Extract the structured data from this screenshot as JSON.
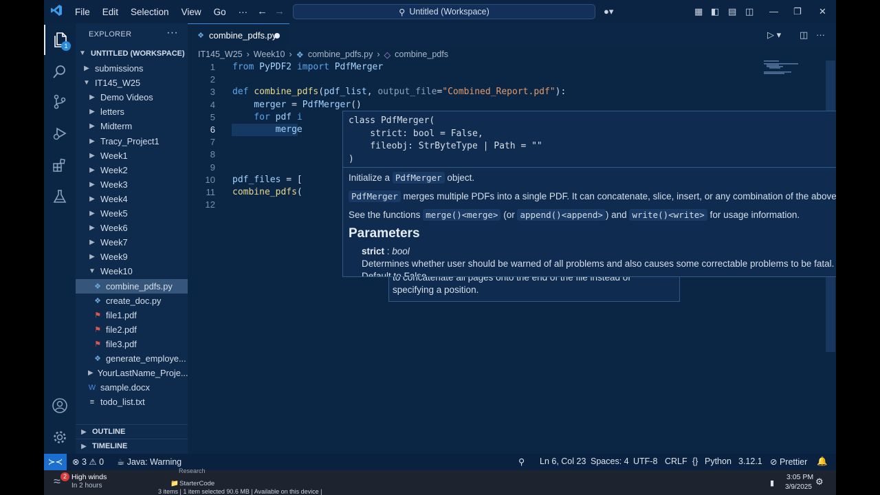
{
  "titlebar": {
    "logo": "<",
    "menus": [
      "File",
      "Edit",
      "Selection",
      "View",
      "Go",
      "···"
    ],
    "search_text": "Untitled (Workspace)"
  },
  "activity": {
    "explorer_badge": "1"
  },
  "sidebar": {
    "title": "EXPLORER",
    "workspace": "UNTITLED (WORKSPACE)",
    "items": [
      {
        "label": "submissions",
        "kind": "folder",
        "indent": 1
      },
      {
        "label": "IT145_W25",
        "kind": "folder-open",
        "indent": 1
      },
      {
        "label": "Demo Videos",
        "kind": "folder",
        "indent": 2
      },
      {
        "label": "letters",
        "kind": "folder",
        "indent": 2
      },
      {
        "label": "Midterm",
        "kind": "folder",
        "indent": 2
      },
      {
        "label": "Tracy_Project1",
        "kind": "folder",
        "indent": 2
      },
      {
        "label": "Week1",
        "kind": "folder",
        "indent": 2
      },
      {
        "label": "Week2",
        "kind": "folder",
        "indent": 2
      },
      {
        "label": "Week3",
        "kind": "folder",
        "indent": 2
      },
      {
        "label": "Week4",
        "kind": "folder",
        "indent": 2
      },
      {
        "label": "Week5",
        "kind": "folder",
        "indent": 2
      },
      {
        "label": "Week6",
        "kind": "folder",
        "indent": 2
      },
      {
        "label": "Week7",
        "kind": "folder",
        "indent": 2
      },
      {
        "label": "Week9",
        "kind": "folder",
        "indent": 2
      },
      {
        "label": "Week10",
        "kind": "folder-open",
        "indent": 2
      },
      {
        "label": "combine_pdfs.py",
        "kind": "py",
        "indent": 3
      },
      {
        "label": "create_doc.py",
        "kind": "py",
        "indent": 3
      },
      {
        "label": "file1.pdf",
        "kind": "pdf",
        "indent": 3
      },
      {
        "label": "file2.pdf",
        "kind": "pdf",
        "indent": 3
      },
      {
        "label": "file3.pdf",
        "kind": "pdf",
        "indent": 3
      },
      {
        "label": "generate_employe...",
        "kind": "py",
        "indent": 3
      },
      {
        "label": "YourLastName_Proje...",
        "kind": "folder",
        "indent": 2
      },
      {
        "label": "sample.docx",
        "kind": "doc",
        "indent": 2
      },
      {
        "label": "todo_list.txt",
        "kind": "txt",
        "indent": 2
      }
    ],
    "selected_index": 15,
    "outline": "OUTLINE",
    "timeline": "TIMELINE"
  },
  "editor": {
    "tab_label": "combine_pdfs.py",
    "breadcrumb": [
      "IT145_W25",
      "Week10",
      "combine_pdfs.py",
      "combine_pdfs"
    ],
    "line_numbers": [
      "1",
      "2",
      "3",
      "4",
      "5",
      "6",
      "7",
      "8",
      "9",
      "10",
      "11",
      "12"
    ],
    "current_line": "6",
    "code_lines": [
      [
        {
          "t": "from ",
          "c": "kw"
        },
        {
          "t": "PyPDF2 ",
          "c": "var"
        },
        {
          "t": "import ",
          "c": "kw"
        },
        {
          "t": "PdfMerger",
          "c": "var"
        }
      ],
      [],
      [
        {
          "t": "def ",
          "c": "kw"
        },
        {
          "t": "combine_pdfs",
          "c": "fn"
        },
        {
          "t": "(",
          "c": "plain"
        },
        {
          "t": "pdf_list",
          "c": "var"
        },
        {
          "t": ", ",
          "c": "plain"
        },
        {
          "t": "output_file",
          "c": "param"
        },
        {
          "t": "=",
          "c": "plain"
        },
        {
          "t": "\"Combined_Report.pdf\"",
          "c": "str"
        },
        {
          "t": "):",
          "c": "plain"
        }
      ],
      [
        {
          "t": "    merger ",
          "c": "var"
        },
        {
          "t": "= ",
          "c": "plain"
        },
        {
          "t": "PdfMerger",
          "c": "var"
        },
        {
          "t": "()",
          "c": "plain"
        }
      ],
      [
        {
          "t": "    for ",
          "c": "kw"
        },
        {
          "t": "pdf ",
          "c": "var"
        },
        {
          "t": "i",
          "c": "kw"
        }
      ],
      [
        {
          "t": "        merge",
          "c": "var"
        }
      ],
      [],
      [],
      [],
      [
        {
          "t": "pdf_files ",
          "c": "var"
        },
        {
          "t": "= [",
          "c": "plain"
        }
      ],
      [
        {
          "t": "combine_pdfs",
          "c": "fn"
        },
        {
          "t": "(",
          "c": "plain"
        }
      ],
      []
    ]
  },
  "hover": {
    "signature": "class PdfMerger(\n    strict: bool = False,\n    fileobj: StrByteType | Path = \"\"\n)",
    "intro_pre": "Initialize a",
    "intro_code": "PdfMerger",
    "intro_post": "object.",
    "desc_code": "PdfMerger",
    "desc_text": "merges multiple PDFs into a single PDF. It can concatenate, slice, insert, or any combination of the above.",
    "see_pre": "See the functions",
    "see_merge": "merge()<merge>",
    "see_or": "(or",
    "see_append": "append()<append>",
    "see_and": ") and",
    "see_write": "write()<write>",
    "see_post": "for usage information.",
    "params_heading": "Parameters",
    "param_name": "strict",
    "param_sep": " : ",
    "param_type": "bool",
    "param_desc": "Determines whether user should be warned of all problems and also causes some correctable problems to be fatal.",
    "param_cut": "Default to False"
  },
  "hover2": {
    "line1": "to concatenate all pages onto the end of the file instead of",
    "line2": "specifying a position."
  },
  "status": {
    "errors": "3",
    "warnings": "0",
    "java": "Java: Warning",
    "position": "Ln 6, Col 23",
    "spaces": "Spaces: 4",
    "encoding": "UTF-8",
    "eol": "CRLF",
    "braces": "{}",
    "language": "Python",
    "python_version": "3.12.1",
    "prettier": "Prettier"
  },
  "taskbar": {
    "weather_badge": "2",
    "weather_title": "High winds",
    "weather_sub": "In 2 hours",
    "behind_1": "Research",
    "behind_2": "StarterCode",
    "explorer_status": "3 items   |   1 item selected  90.6 MB   |   Available on this device  |",
    "time": "3:05 PM",
    "date": "3/9/2025"
  }
}
